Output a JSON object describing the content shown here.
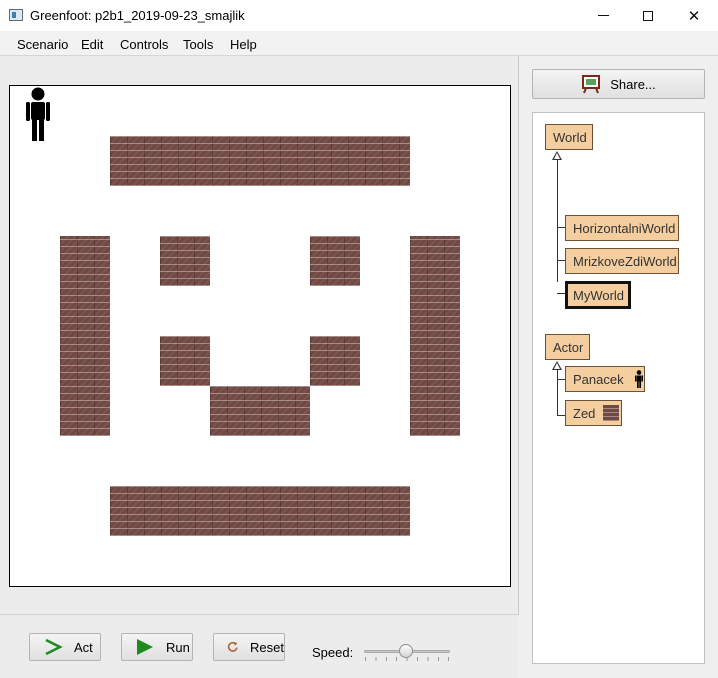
{
  "window": {
    "title": "Greenfoot: p2b1_2019-09-23_smajlik",
    "minimize": "minimize",
    "maximize": "maximize",
    "close": "✕"
  },
  "menu": [
    "Scenario",
    "Edit",
    "Controls",
    "Tools",
    "Help"
  ],
  "controls": {
    "act_label": "Act",
    "run_label": "Run",
    "reset_label": "Reset",
    "speed_label": "Speed:",
    "speed_fraction": 0.5
  },
  "share": {
    "label": "Share..."
  },
  "classes": {
    "world_root": "World",
    "world_subclasses": [
      "HorizontalniWorld",
      "MrizkoveZdiWorld",
      "MyWorld"
    ],
    "selected_world": "MyWorld",
    "actor_root": "Actor",
    "actor_subclasses": [
      "Panacek",
      "Zed"
    ]
  },
  "colors": {
    "class_box": "#f5ce9f",
    "wall": "#6f4a45",
    "run_arrow": "#1f8a1f",
    "act_arrow": "#1f8a1f",
    "reset_arrow": "#b0623a"
  },
  "icons": {
    "person": "person-icon",
    "wall": "brick-wall-icon",
    "share": "easel-icon"
  }
}
